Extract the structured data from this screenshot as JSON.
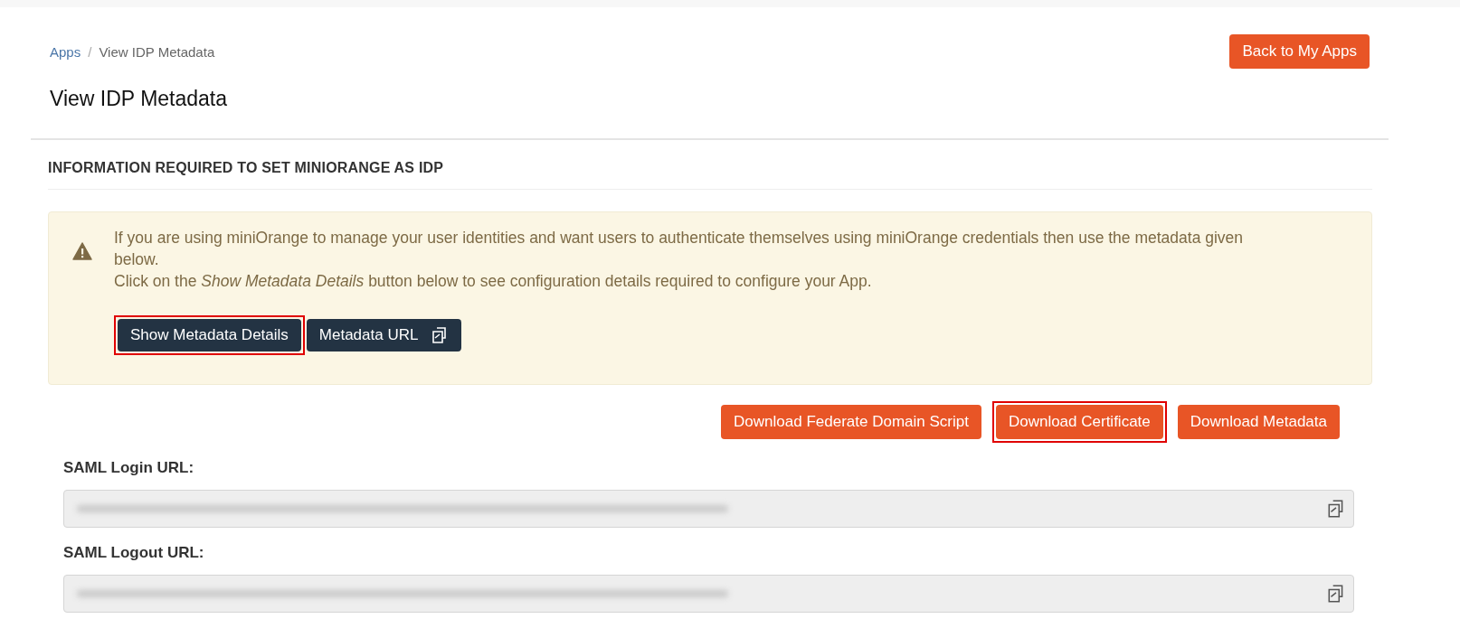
{
  "breadcrumb": [
    {
      "label": "Apps",
      "kind": "link"
    },
    {
      "label": "/",
      "kind": "separator"
    },
    {
      "label": "View IDP Metadata",
      "kind": "current"
    }
  ],
  "back_button": {
    "label": "Back to My Apps"
  },
  "title": "View IDP Metadata",
  "section_heading": "INFORMATION REQUIRED TO SET MINIORANGE AS IDP",
  "alert": {
    "text": "If you are using miniOrange to manage your user identities and want users to authenticate themselves using miniOrange credentials then use the metadata given below.",
    "text_2": "Click on the *Show Metadata Details* button below to see configuration details required to configure your App.",
    "buttons": [
      {
        "label": "Show Metadata Details",
        "highlighted": true,
        "copy_icon": false
      },
      {
        "label": "Metadata URL",
        "highlighted": false,
        "copy_icon": true
      }
    ]
  },
  "download_buttons": [
    {
      "label": "Download Federate Domain Script",
      "highlighted": false
    },
    {
      "label": "Download Certificate",
      "highlighted": true
    },
    {
      "label": "Download Metadata",
      "highlighted": false
    }
  ],
  "fields": [
    {
      "label": "SAML Login URL:",
      "redacted": true
    },
    {
      "label": "SAML Logout URL:",
      "redacted": true
    }
  ]
}
